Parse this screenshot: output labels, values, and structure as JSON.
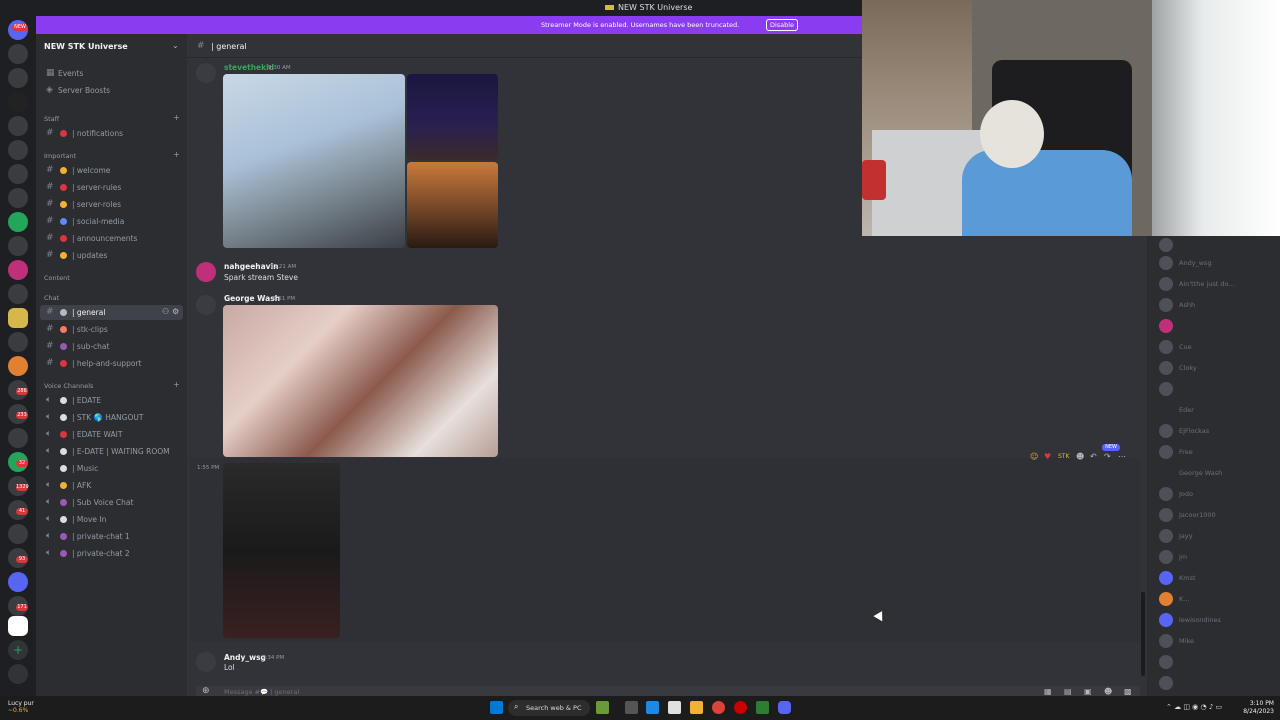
{
  "window": {
    "title": "NEW STK Universe"
  },
  "banner": {
    "message": "Streamer Mode is enabled. Usernames have been truncated.",
    "button": "Disable"
  },
  "server": {
    "name": "NEW STK Universe"
  },
  "sidebar": {
    "top_items": [
      {
        "label": "Events"
      },
      {
        "label": "Server Boosts"
      }
    ],
    "categories": {
      "staff": "Staff",
      "important": "Important",
      "content": "Content",
      "chat": "Chat",
      "voice": "Voice Channels"
    },
    "staff_channels": [
      {
        "label": "| notifications",
        "color": "#da373c"
      }
    ],
    "important_channels": [
      {
        "label": "| welcome",
        "color": "#f0b232"
      },
      {
        "label": "| server-rules",
        "color": "#da373c"
      },
      {
        "label": "| server-roles",
        "color": "#f0b232"
      },
      {
        "label": "| social-media",
        "color": "#5b8def"
      },
      {
        "label": "| announcements",
        "color": "#da373c"
      },
      {
        "label": "| updates",
        "color": "#f0b232"
      }
    ],
    "chat_channels": [
      {
        "label": "| general",
        "color": "#b5bac1",
        "active": true
      },
      {
        "label": "| stk-clips",
        "color": "#f47b67"
      },
      {
        "label": "| sub-chat",
        "color": "#9b59b6"
      },
      {
        "label": "| help-and-support",
        "color": "#da373c"
      }
    ],
    "voice_channels": [
      {
        "label": "| EDATE",
        "color": "#dbdee1"
      },
      {
        "label": "| STK 🌎 HANGOUT",
        "color": "#dbdee1"
      },
      {
        "label": "| EDATE WAIT",
        "color": "#da373c"
      },
      {
        "label": "| E-DATE | WAITING ROOM",
        "color": "#dbdee1"
      },
      {
        "label": "| Music",
        "color": "#dbdee1"
      },
      {
        "label": "| AFK",
        "color": "#f0b232"
      },
      {
        "label": "| Sub Voice Chat",
        "color": "#9b59b6"
      },
      {
        "label": "| Move In",
        "color": "#dbdee1"
      },
      {
        "label": "| private-chat 1",
        "color": "#9b59b6"
      },
      {
        "label": "| private-chat 2",
        "color": "#9b59b6"
      }
    ]
  },
  "channel": {
    "name": "| general"
  },
  "messages": [
    {
      "user": "stevethekid",
      "time": "9:30 AM",
      "user_color": "#3ba55d"
    },
    {
      "user": "nahgeehavin",
      "time": "11:21 AM",
      "text": "Spark stream Steve"
    },
    {
      "user": "George Wash",
      "time": "1:51 PM"
    },
    {
      "time": "1:55 PM"
    },
    {
      "user": "Andy_wsg",
      "time": "2:34 PM",
      "text": "Lol"
    }
  ],
  "toolbar": {
    "new_label": "NEW",
    "stk": "STK"
  },
  "input": {
    "placeholder": "Message #💬 | general"
  },
  "rail_badges": [
    "NEW",
    "288",
    "233",
    "32",
    "1329",
    "41",
    "93",
    "171"
  ],
  "members": [
    "Andy_wsg",
    "Ain'tthe just do...",
    "Ashh",
    "Cue",
    "Cloky",
    "Eder",
    "EJFlockas",
    "Free",
    "George Wash",
    "Jodo",
    "Jacoor1000",
    "Jayy",
    "jm",
    "Kmst",
    "K...",
    "lewisondines",
    "Mike"
  ],
  "taskbar": {
    "search": "Search web & PC",
    "time": "3:10 PM",
    "date": "8/24/2023",
    "weather_temp": "Lucy pur",
    "weather_desc": "~0.6%"
  }
}
